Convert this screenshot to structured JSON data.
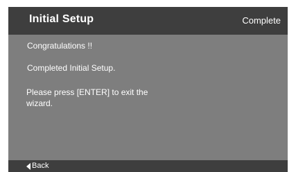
{
  "header": {
    "title": "Initial Setup",
    "step": "Complete"
  },
  "content": {
    "line1": "Congratulations !!",
    "line2": "Completed Initial Setup.",
    "line3": "Please press [ENTER] to exit the wizard."
  },
  "footer": {
    "back_label": "Back",
    "back_icon": "left-triangle-arrow-icon"
  },
  "colors": {
    "panel_bg": "#7e7e7e",
    "bar_bg": "#3e3e3e",
    "text": "#ffffff"
  }
}
